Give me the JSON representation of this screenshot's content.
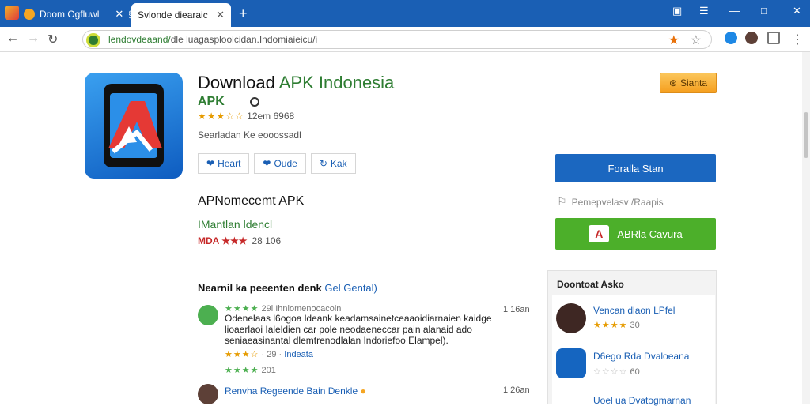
{
  "browser": {
    "tab1_title": "Doom Ogfluwl",
    "tab2_title": "Svlonde diearaic",
    "new_tab": "+",
    "url_host": "lendovdeaand/",
    "url_path": "dle luagasploolcidan.Indomiaieicu/i",
    "win_controls": [
      "▣",
      "☰",
      "—",
      "□",
      "✕"
    ]
  },
  "app": {
    "title_part1": "Download ",
    "title_part2": "APK Indonesia",
    "apk_label": "APK",
    "rating_stars": "★★★☆☆",
    "rating_text": "12em 6968",
    "subtitle": "Searladan Ke eooossadl",
    "buttons": [
      {
        "icon": "❤",
        "label": "Heart"
      },
      {
        "icon": "❤",
        "label": "Oude"
      },
      {
        "icon": "↻",
        "label": "Kak"
      }
    ],
    "orange_button": "Sianta",
    "blue_button": "Foralla Stan",
    "report_text": "Pemepvelasv /Raapis",
    "green_button": "ABRla Cavura",
    "green_icon_letter": "A"
  },
  "section2": {
    "title": "APNomecemt APK",
    "subtitle": "IMantlan ldencl",
    "rating_prefix": "MDA ",
    "rating_stars": "★★★",
    "rating_count": "28 106"
  },
  "reviews": {
    "heading": "Nearnil ka peeenten denk ",
    "heading_link": "Gel Gental)",
    "items": [
      {
        "meta_stars": "★★★★",
        "meta_text": "29i Ihnlomenocacoin",
        "time": "1 16an",
        "text": "Odenelaas l6ogoa ldeank keadamsainetceaaoidiarnaien kaidge lioaerlaoi Ialeldien car pole neodaeneccar pain alanaid ado seniaeasinantal dlemtrenodlalan Indoriefoo Elampel).",
        "sub_stars": "★★★☆",
        "sub_text": "29",
        "sub_link": "Indeata",
        "extra_stars": "★★★★",
        "extra_text": "201"
      },
      {
        "name": "Renvha Regeende Bain Denkle",
        "time": "1 26an"
      }
    ]
  },
  "sidebar": {
    "title": "Doontoat Asko",
    "items": [
      {
        "name": "Vencan dlaon LPfel",
        "stars": "★★★★",
        "count": "30"
      },
      {
        "name": "D6ego Rda Dvaloeana",
        "stars": "☆☆☆☆",
        "count": "60"
      },
      {
        "name": "Uoel ua Dvatogmarnan",
        "stars": "",
        "count": ""
      }
    ]
  }
}
